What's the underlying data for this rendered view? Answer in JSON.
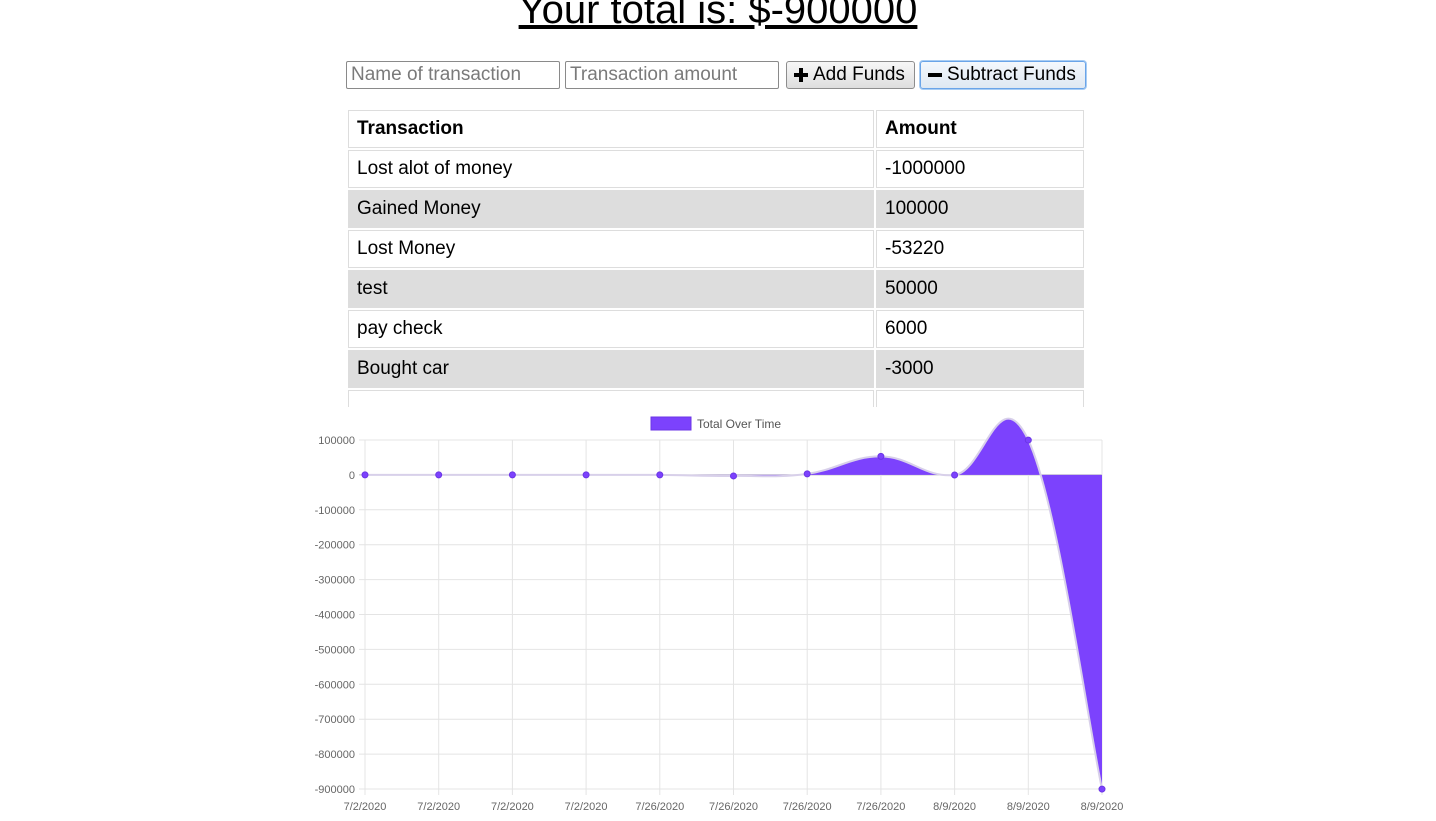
{
  "header": {
    "total_label": "Your total is: $-900000"
  },
  "form": {
    "name_placeholder": "Name of transaction",
    "amount_placeholder": "Transaction amount",
    "add_label": "Add Funds",
    "subtract_label": "Subtract Funds",
    "add_icon": "plus-icon",
    "subtract_icon": "minus-icon"
  },
  "table": {
    "headers": [
      "Transaction",
      "Amount"
    ],
    "rows": [
      {
        "name": "Lost alot of money",
        "amount": "-1000000"
      },
      {
        "name": "Gained Money",
        "amount": "100000"
      },
      {
        "name": "Lost Money",
        "amount": "-53220"
      },
      {
        "name": "test",
        "amount": "50000"
      },
      {
        "name": "pay check",
        "amount": "6000"
      },
      {
        "name": "Bought car",
        "amount": "-3000"
      }
    ]
  },
  "chart_data": {
    "type": "area",
    "series": [
      {
        "name": "Total Over Time",
        "color": "#7c42fd",
        "values": [
          0,
          0,
          0,
          0,
          0,
          -3000,
          3000,
          53000,
          -220,
          99780,
          -900220
        ]
      }
    ],
    "categories": [
      "7/2/2020",
      "7/2/2020",
      "7/2/2020",
      "7/2/2020",
      "7/26/2020",
      "7/26/2020",
      "7/26/2020",
      "7/26/2020",
      "8/9/2020",
      "8/9/2020",
      "8/9/2020"
    ],
    "y_ticks": [
      "100000",
      "0",
      "-100000",
      "-200000",
      "-300000",
      "-400000",
      "-500000",
      "-600000",
      "-700000",
      "-800000",
      "-900000"
    ],
    "ylim": [
      -900000,
      100000
    ],
    "grid": true,
    "legend_position": "top"
  }
}
